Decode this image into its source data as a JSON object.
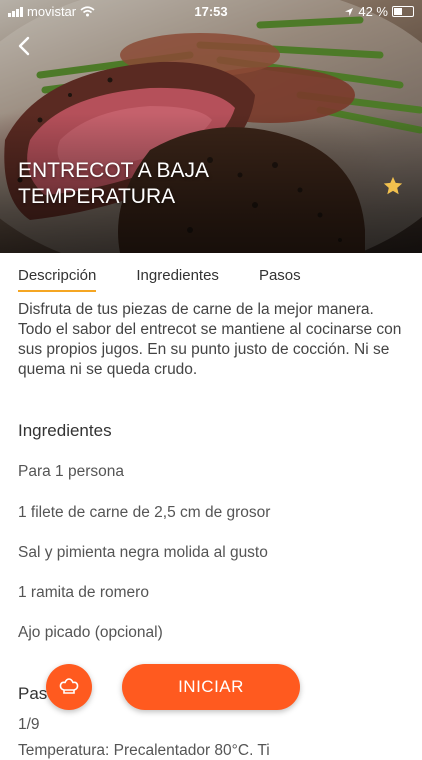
{
  "status_bar": {
    "carrier": "movistar",
    "time": "17:53",
    "battery": "42 %",
    "battery_level": 0.42
  },
  "recipe": {
    "title": "ENTRECOT A BAJA TEMPERATURA"
  },
  "tabs": [
    {
      "label": "Descripción",
      "active": true
    },
    {
      "label": "Ingredientes",
      "active": false
    },
    {
      "label": "Pasos",
      "active": false
    }
  ],
  "description": "Disfruta de tus piezas de carne de la mejor manera.  Todo el sabor del entrecot se mantiene al cocinarse con sus propios jugos. En su punto justo de cocción. Ni se quema ni se queda crudo.",
  "ingredients": {
    "heading": "Ingredientes",
    "servings": "Para 1 persona",
    "items": [
      "1 filete de carne de 2,5 cm de grosor",
      "Sal y pimienta negra molida al gusto",
      "1 ramita de romero",
      "Ajo picado (opcional)"
    ]
  },
  "steps": {
    "heading": "Pasos",
    "counter": "1/9",
    "first_line": "Temperatura: Precalentador 80°C. Ti"
  },
  "actions": {
    "start_label": "INICIAR"
  },
  "colors": {
    "accent": "#ff5a1f",
    "tab_underline": "#f5a623",
    "star": "#f2c14e"
  },
  "icons": {
    "back": "chevron-left-icon",
    "favorite": "star-icon",
    "chef": "chef-hat-icon",
    "wifi": "wifi-icon",
    "location": "location-arrow-icon"
  }
}
